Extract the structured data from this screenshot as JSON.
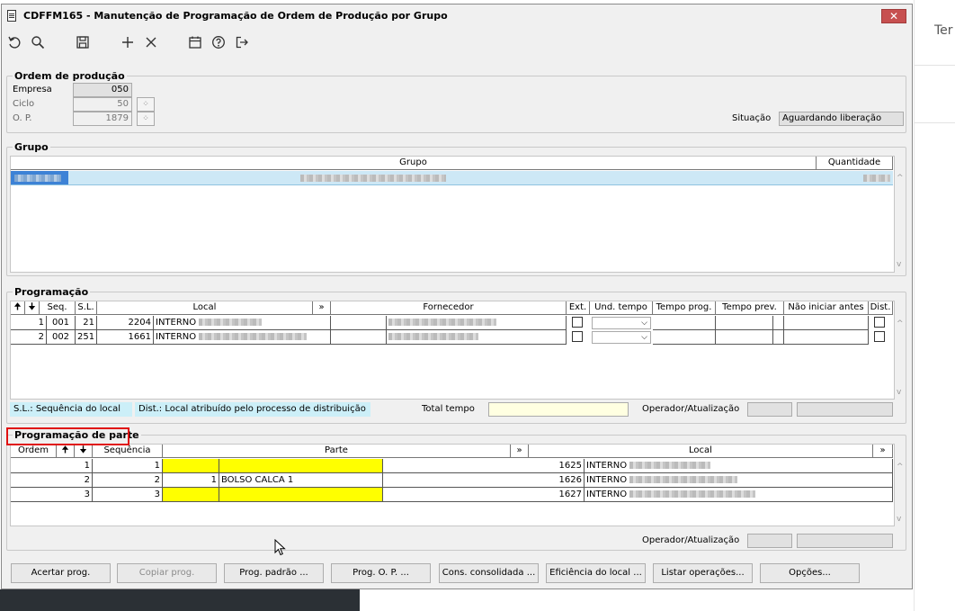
{
  "window": {
    "title": "CDFFM165 - Manutenção de Programação de Ordem de Produção por Grupo",
    "close_label": "✕"
  },
  "toolbar": {
    "icons": [
      "undo-icon",
      "search-icon",
      "save-icon",
      "add-icon",
      "delete-icon",
      "calendar-icon",
      "help-icon",
      "exit-icon"
    ]
  },
  "ordem": {
    "legend": "Ordem de produção",
    "empresa_label": "Empresa",
    "empresa_value": "050",
    "ciclo_label": "Ciclo",
    "ciclo_value": "50",
    "op_label": "O. P.",
    "op_value": "1879",
    "situacao_label": "Situação",
    "situacao_value": "Aguardando liberação"
  },
  "grupo": {
    "legend": "Grupo",
    "headers": [
      "Grupo",
      "Quantidade"
    ]
  },
  "programacao": {
    "legend": "Programação",
    "headers": [
      "Seq.",
      "S.L.",
      "Local",
      "»",
      "Fornecedor",
      "Ext.",
      "Und. tempo",
      "Tempo prog.",
      "Tempo prev.",
      "Não iniciar antes",
      "Dist."
    ],
    "rows": [
      {
        "n": "1",
        "seq": "001",
        "sl": "21",
        "code": "2204",
        "local": "INTERNO"
      },
      {
        "n": "2",
        "seq": "002",
        "sl": "251",
        "code": "1661",
        "local": "INTERNO"
      }
    ],
    "info_sl": "S.L.: Sequência do local",
    "info_dist": "Dist.: Local atribuído pelo processo de distribuição",
    "total_label": "Total tempo",
    "operador_label": "Operador/Atualização"
  },
  "parte": {
    "legend": "Programação de parte",
    "headers": [
      "Ordem",
      "Sequência",
      "Parte",
      "»",
      "Local",
      "»"
    ],
    "rows": [
      {
        "ordem": "1",
        "seq": "1",
        "pn": "",
        "parte": "",
        "code": "1625",
        "local": "INTERNO"
      },
      {
        "ordem": "2",
        "seq": "2",
        "pn": "1",
        "parte": "BOLSO CALCA 1",
        "code": "1626",
        "local": "INTERNO"
      },
      {
        "ordem": "3",
        "seq": "3",
        "pn": "",
        "parte": "",
        "code": "1627",
        "local": "INTERNO"
      }
    ],
    "operador_label": "Operador/Atualização"
  },
  "buttons": {
    "acertar": "Acertar prog.",
    "copiar": "Copiar prog.",
    "padrao": "Prog. padrão ...",
    "op": "Prog. O. P. ...",
    "cons": "Cons. consolidada ...",
    "eficiencia": "Eficiência do local ...",
    "listar": "Listar operações...",
    "opcoes": "Opções..."
  },
  "background": {
    "right_text": "Ter"
  }
}
